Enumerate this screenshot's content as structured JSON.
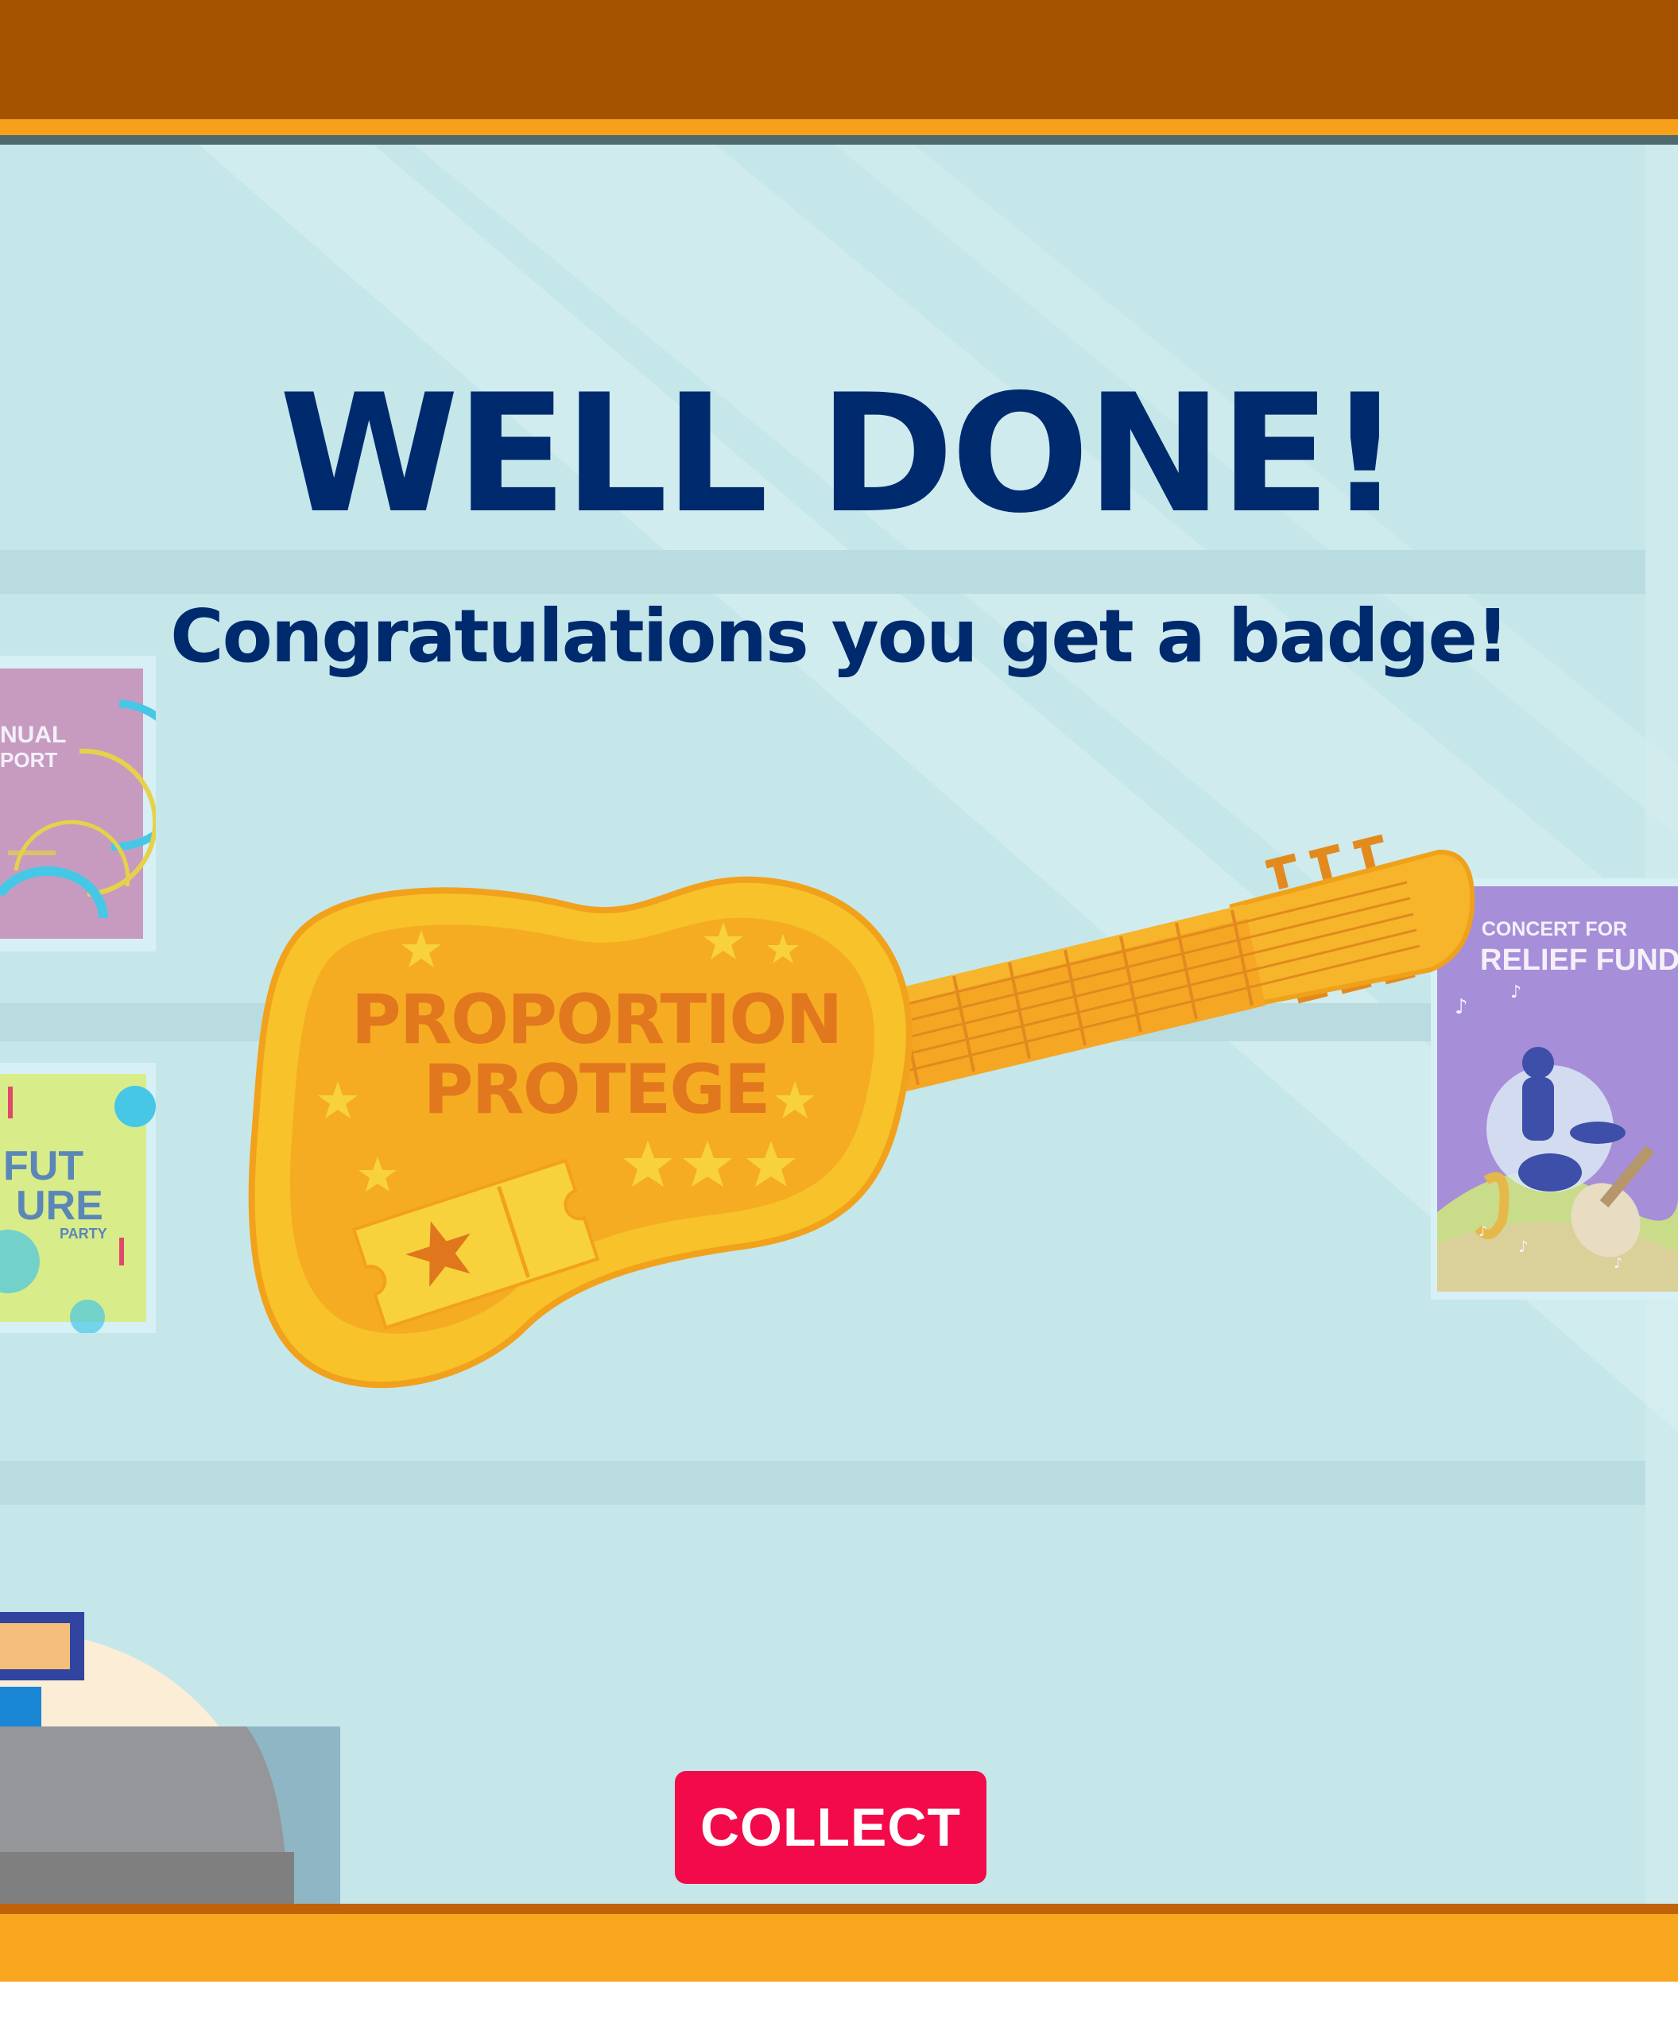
{
  "screen": {
    "title": "WELL DONE!",
    "subtitle": "Congratulations you get a badge!",
    "collect_label": "COLLECT"
  },
  "badge": {
    "line1": "PROPORTION",
    "line2": "PROTEGE"
  },
  "posters": {
    "annual_line1": "NUAL",
    "annual_line2": "PORT",
    "future_line1": "FUT",
    "future_line2": "URE",
    "future_line3": "PARTY",
    "concert_line1": "CONCERT FOR",
    "concert_line2": "RELIEF FUND"
  },
  "colors": {
    "title": "#002a6e",
    "button": "#f20a4a",
    "wall": "#c5e7e9",
    "frame_dark": "#a65300",
    "frame_light": "#f8a019",
    "badge_gold": "#f5b021"
  }
}
